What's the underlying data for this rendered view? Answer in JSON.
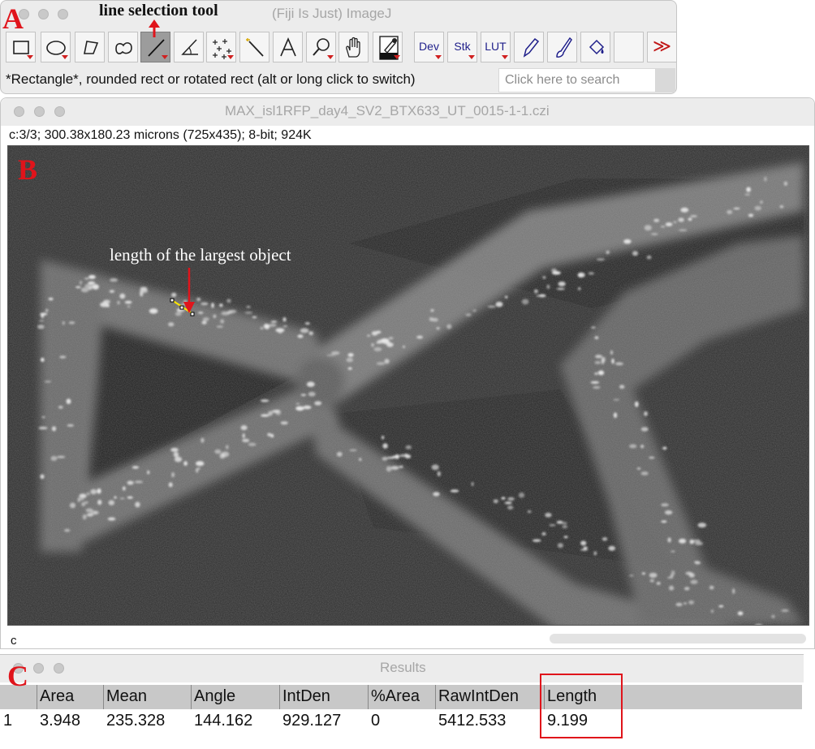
{
  "windowA": {
    "title": "(Fiji Is Just) ImageJ",
    "status": "*Rectangle*, rounded rect or rotated rect (alt or long click to switch)",
    "search_placeholder": "Click here to search",
    "tools": [
      {
        "name": "rectangle-tool-icon"
      },
      {
        "name": "oval-tool-icon"
      },
      {
        "name": "polygon-tool-icon"
      },
      {
        "name": "freehand-tool-icon"
      },
      {
        "name": "line-tool-icon",
        "selected": true
      },
      {
        "name": "angle-tool-icon"
      },
      {
        "name": "multipoint-tool-icon"
      },
      {
        "name": "wand-tool-icon"
      },
      {
        "name": "text-tool-icon"
      },
      {
        "name": "zoom-tool-icon"
      },
      {
        "name": "hand-tool-icon"
      },
      {
        "name": "color-picker-tool-icon"
      },
      {
        "name": "dev-menu-button",
        "label": "Dev"
      },
      {
        "name": "stk-menu-button",
        "label": "Stk"
      },
      {
        "name": "lut-menu-button",
        "label": "LUT"
      },
      {
        "name": "pencil-tool-icon"
      },
      {
        "name": "brush-tool-icon"
      },
      {
        "name": "flood-fill-tool-icon"
      },
      {
        "name": "empty-slot"
      },
      {
        "name": "more-tools-icon",
        "label": "≫"
      }
    ]
  },
  "windowB": {
    "title": "MAX_isl1RFP_day4_SV2_BTX633_UT_0015-1-1.czi",
    "info": "c:3/3; 300.38x180.23 microns (725x435); 8-bit; 924K",
    "channel_label": "c"
  },
  "windowC": {
    "title": "Results",
    "columns": [
      "Area",
      "Mean",
      "Angle",
      "IntDen",
      "%Area",
      "RawIntDen",
      "Length"
    ],
    "rows": [
      {
        "index": "1",
        "values": [
          "3.948",
          "235.328",
          "144.162",
          "929.127",
          "0",
          "5412.533",
          "9.199"
        ]
      }
    ]
  },
  "annotations": {
    "panel_a": "A",
    "panel_b": "B",
    "panel_c": "C",
    "line_tool_label": "line selection tool",
    "largest_object_label": "length of the largest object"
  },
  "colors": {
    "annotation_red": "#e0141b",
    "selected_tool": "#9c9c9c",
    "highlight_box": "#e0141b"
  }
}
